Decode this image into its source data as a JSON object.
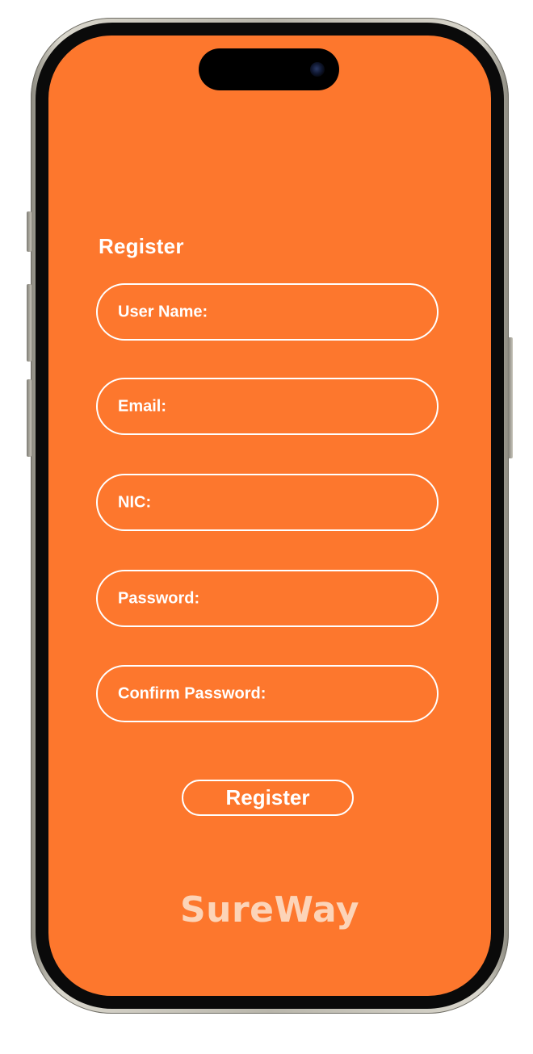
{
  "app": {
    "accent_color": "#fd772d",
    "logo_color": "#fcd4b8"
  },
  "form": {
    "title": "Register",
    "fields": [
      {
        "label": "User Name:"
      },
      {
        "label": "Email:"
      },
      {
        "label": "NIC:"
      },
      {
        "label": "Password:"
      },
      {
        "label": "Confirm Password:"
      }
    ],
    "submit_label": "Register"
  },
  "brand": {
    "name": "SureWay"
  }
}
